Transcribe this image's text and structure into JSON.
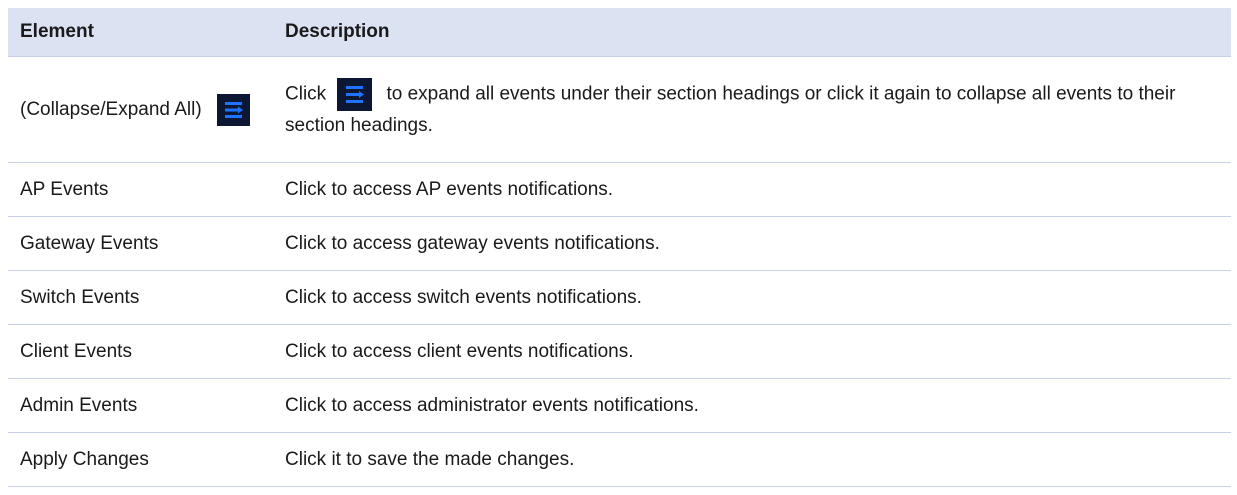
{
  "table": {
    "headers": {
      "element": "Element",
      "description": "Description"
    },
    "collapse_row": {
      "element_label": "(Collapse/Expand All)",
      "element_icon": "collapse-expand-icon",
      "desc_prefix": "Click",
      "desc_icon": "collapse-expand-icon",
      "desc_suffix": "to expand all events under their section headings or click it again to collapse all events to their section headings."
    },
    "rows": [
      {
        "element": "AP Events",
        "description": "Click to access AP events notifications."
      },
      {
        "element": "Gateway Events",
        "description": "Click to access gateway events notifications."
      },
      {
        "element": "Switch Events",
        "description": "Click to access switch events notifications."
      },
      {
        "element": "Client Events",
        "description": "Click to access client events notifications."
      },
      {
        "element": "Admin Events",
        "description": "Click to access administrator events notifications."
      },
      {
        "element": "Apply Changes",
        "description": "Click it to save the made changes."
      }
    ]
  },
  "colors": {
    "header_bg": "#dbe2f2",
    "icon_bg": "#0b1733",
    "icon_fg": "#1e73ff"
  }
}
